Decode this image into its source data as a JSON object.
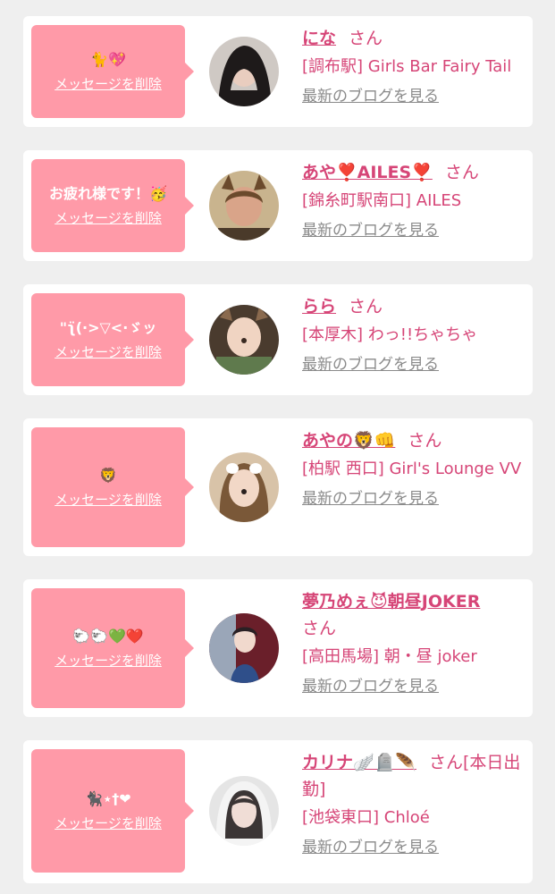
{
  "cards": [
    {
      "message": "🐈💖",
      "delete_label": "メッセージを削除",
      "name": "にな",
      "honorific": "さん",
      "shop": "[調布駅] Girls Bar Fairy Tail",
      "blog_label": "最新のブログを見る",
      "avatar_colors": [
        "#cfc9c4",
        "#1e1a1a",
        "#e9cdbf"
      ]
    },
    {
      "message": "お疲れ様です！🥳",
      "delete_label": "メッセージを削除",
      "name": "あや❣️AILES❣️",
      "honorific": "さん",
      "shop": "[錦糸町駅南口] AILES",
      "blog_label": "最新のブログを見る",
      "avatar_colors": [
        "#c9b48e",
        "#6b4a2c",
        "#d9a489"
      ]
    },
    {
      "message": "\"ʅ̈(·>▽<·ゞッ",
      "delete_label": "メッセージを削除",
      "name": "らら",
      "honorific": "さん",
      "shop": "[本厚木] わっ!!ちゃちゃ",
      "blog_label": "最新のブログを見る",
      "avatar_colors": [
        "#5f7a4d",
        "#4a3b2e",
        "#f0d4c2"
      ]
    },
    {
      "message": "🦁",
      "delete_label": "メッセージを削除",
      "name": "あやの🦁👊",
      "honorific": "さん",
      "shop": "[柏駅 西口] Girl's Lounge VV",
      "blog_label": "最新のブログを見る",
      "avatar_colors": [
        "#d8c3a8",
        "#7a5838",
        "#f2d8c7"
      ]
    },
    {
      "message": "🐑🐑💚❤️",
      "delete_label": "メッセージを削除",
      "name": "夢乃めぇ😈朝昼JOKER",
      "honorific": "さん",
      "shop": "[高田馬場] 朝・昼 joker",
      "blog_label": "最新のブログを見る",
      "avatar_colors": [
        "#6a1f2a",
        "#2f4f8a",
        "#f1d9cd"
      ]
    },
    {
      "message": "🐈‍⬛⋆†❤",
      "delete_label": "メッセージを削除",
      "name": "カリナ🪽🪦🪶",
      "honorific": "さん[本日出勤]",
      "shop": "[池袋東口] Chloé",
      "blog_label": "最新のブログを見る",
      "avatar_colors": [
        "#e5e5e5",
        "#3b3535",
        "#f0ddd6"
      ]
    }
  ]
}
